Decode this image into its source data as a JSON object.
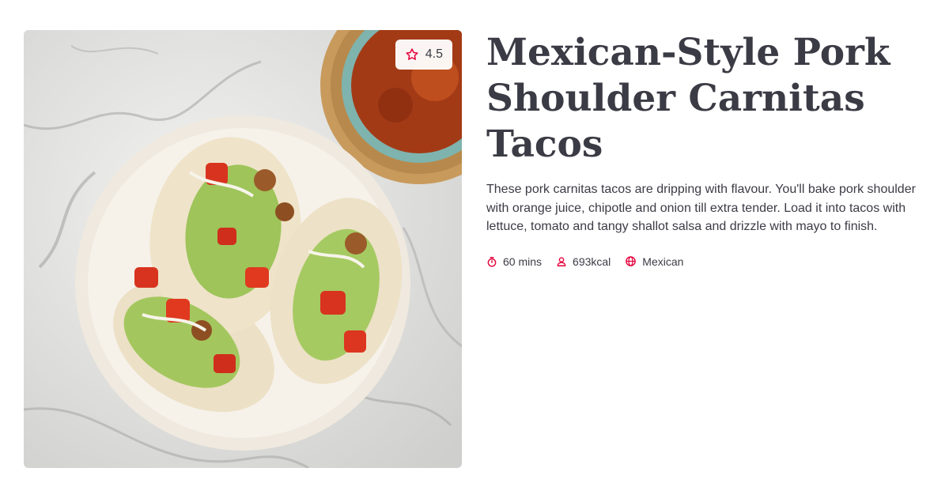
{
  "recipe": {
    "title": "Mexican-Style Pork Shoulder Carnitas Tacos",
    "description": "These pork carnitas tacos are dripping with flavour. You'll bake pork shoulder with orange juice, chipotle and onion till extra tender. Load it into tacos with lettuce, tomato and tangy shallot salsa and drizzle with mayo to finish.",
    "rating": "4.5",
    "meta": {
      "time": "60 mins",
      "calories": "693kcal",
      "cuisine": "Mexican"
    },
    "icons": {
      "rating": "star-icon",
      "time": "stopwatch-icon",
      "calories": "person-icon",
      "cuisine": "globe-icon"
    }
  },
  "theme": {
    "accent": "#e4003a",
    "text": "#3b3b45"
  }
}
